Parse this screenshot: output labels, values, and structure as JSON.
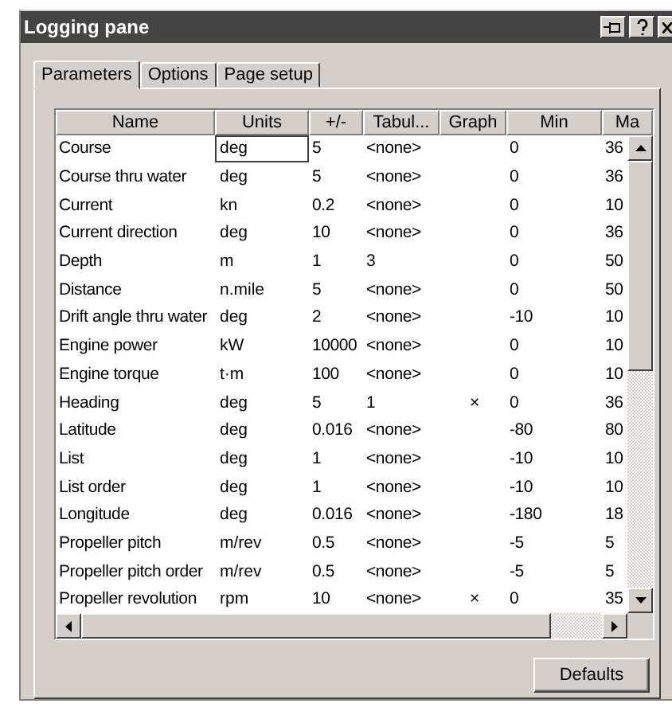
{
  "window": {
    "title": "Logging pane"
  },
  "tabs": [
    {
      "label": "Parameters",
      "selected": true
    },
    {
      "label": "Options",
      "selected": false
    },
    {
      "label": "Page setup",
      "selected": false
    }
  ],
  "table": {
    "columns": [
      "Name",
      "Units",
      "+/-",
      "Tabul...",
      "Graph",
      "Min",
      "Ma"
    ],
    "rows": [
      {
        "name": "Course",
        "units": "deg",
        "step": "5",
        "tabul": "<none>",
        "graph": "",
        "min": "0",
        "max": "36",
        "editing": true
      },
      {
        "name": "Course thru water",
        "units": "deg",
        "step": "5",
        "tabul": "<none>",
        "graph": "",
        "min": "0",
        "max": "36",
        "editing": false
      },
      {
        "name": "Current",
        "units": "kn",
        "step": "0.2",
        "tabul": "<none>",
        "graph": "",
        "min": "0",
        "max": "10",
        "editing": false
      },
      {
        "name": "Current direction",
        "units": "deg",
        "step": "10",
        "tabul": "<none>",
        "graph": "",
        "min": "0",
        "max": "36",
        "editing": false
      },
      {
        "name": "Depth",
        "units": "m",
        "step": "1",
        "tabul": "3",
        "graph": "",
        "min": "0",
        "max": "50",
        "editing": false
      },
      {
        "name": "Distance",
        "units": "n.mile",
        "step": "5",
        "tabul": "<none>",
        "graph": "",
        "min": "0",
        "max": "50",
        "editing": false
      },
      {
        "name": "Drift angle thru water",
        "units": "deg",
        "step": "2",
        "tabul": "<none>",
        "graph": "",
        "min": "-10",
        "max": "10",
        "editing": false
      },
      {
        "name": "Engine power",
        "units": "kW",
        "step": "10000",
        "tabul": "<none>",
        "graph": "",
        "min": "0",
        "max": "10",
        "editing": false
      },
      {
        "name": "Engine torque",
        "units": "t·m",
        "step": "100",
        "tabul": "<none>",
        "graph": "",
        "min": "0",
        "max": "10",
        "editing": false
      },
      {
        "name": "Heading",
        "units": "deg",
        "step": "5",
        "tabul": "1",
        "graph": "×",
        "min": "0",
        "max": "36",
        "editing": false
      },
      {
        "name": "Latitude",
        "units": "deg",
        "step": "0.016",
        "tabul": "<none>",
        "graph": "",
        "min": "-80",
        "max": "80",
        "editing": false
      },
      {
        "name": "List",
        "units": "deg",
        "step": "1",
        "tabul": "<none>",
        "graph": "",
        "min": "-10",
        "max": "10",
        "editing": false
      },
      {
        "name": "List order",
        "units": "deg",
        "step": "1",
        "tabul": "<none>",
        "graph": "",
        "min": "-10",
        "max": "10",
        "editing": false
      },
      {
        "name": "Longitude",
        "units": "deg",
        "step": "0.016",
        "tabul": "<none>",
        "graph": "",
        "min": "-180",
        "max": "18",
        "editing": false
      },
      {
        "name": "Propeller pitch",
        "units": "m/rev",
        "step": "0.5",
        "tabul": "<none>",
        "graph": "",
        "min": "-5",
        "max": "5",
        "editing": false
      },
      {
        "name": "Propeller pitch order",
        "units": "m/rev",
        "step": "0.5",
        "tabul": "<none>",
        "graph": "",
        "min": "-5",
        "max": "5",
        "editing": false
      },
      {
        "name": "Propeller revolution",
        "units": "rpm",
        "step": "10",
        "tabul": "<none>",
        "graph": "×",
        "min": "0",
        "max": "35",
        "editing": false
      }
    ]
  },
  "buttons": [
    "Defaults"
  ]
}
